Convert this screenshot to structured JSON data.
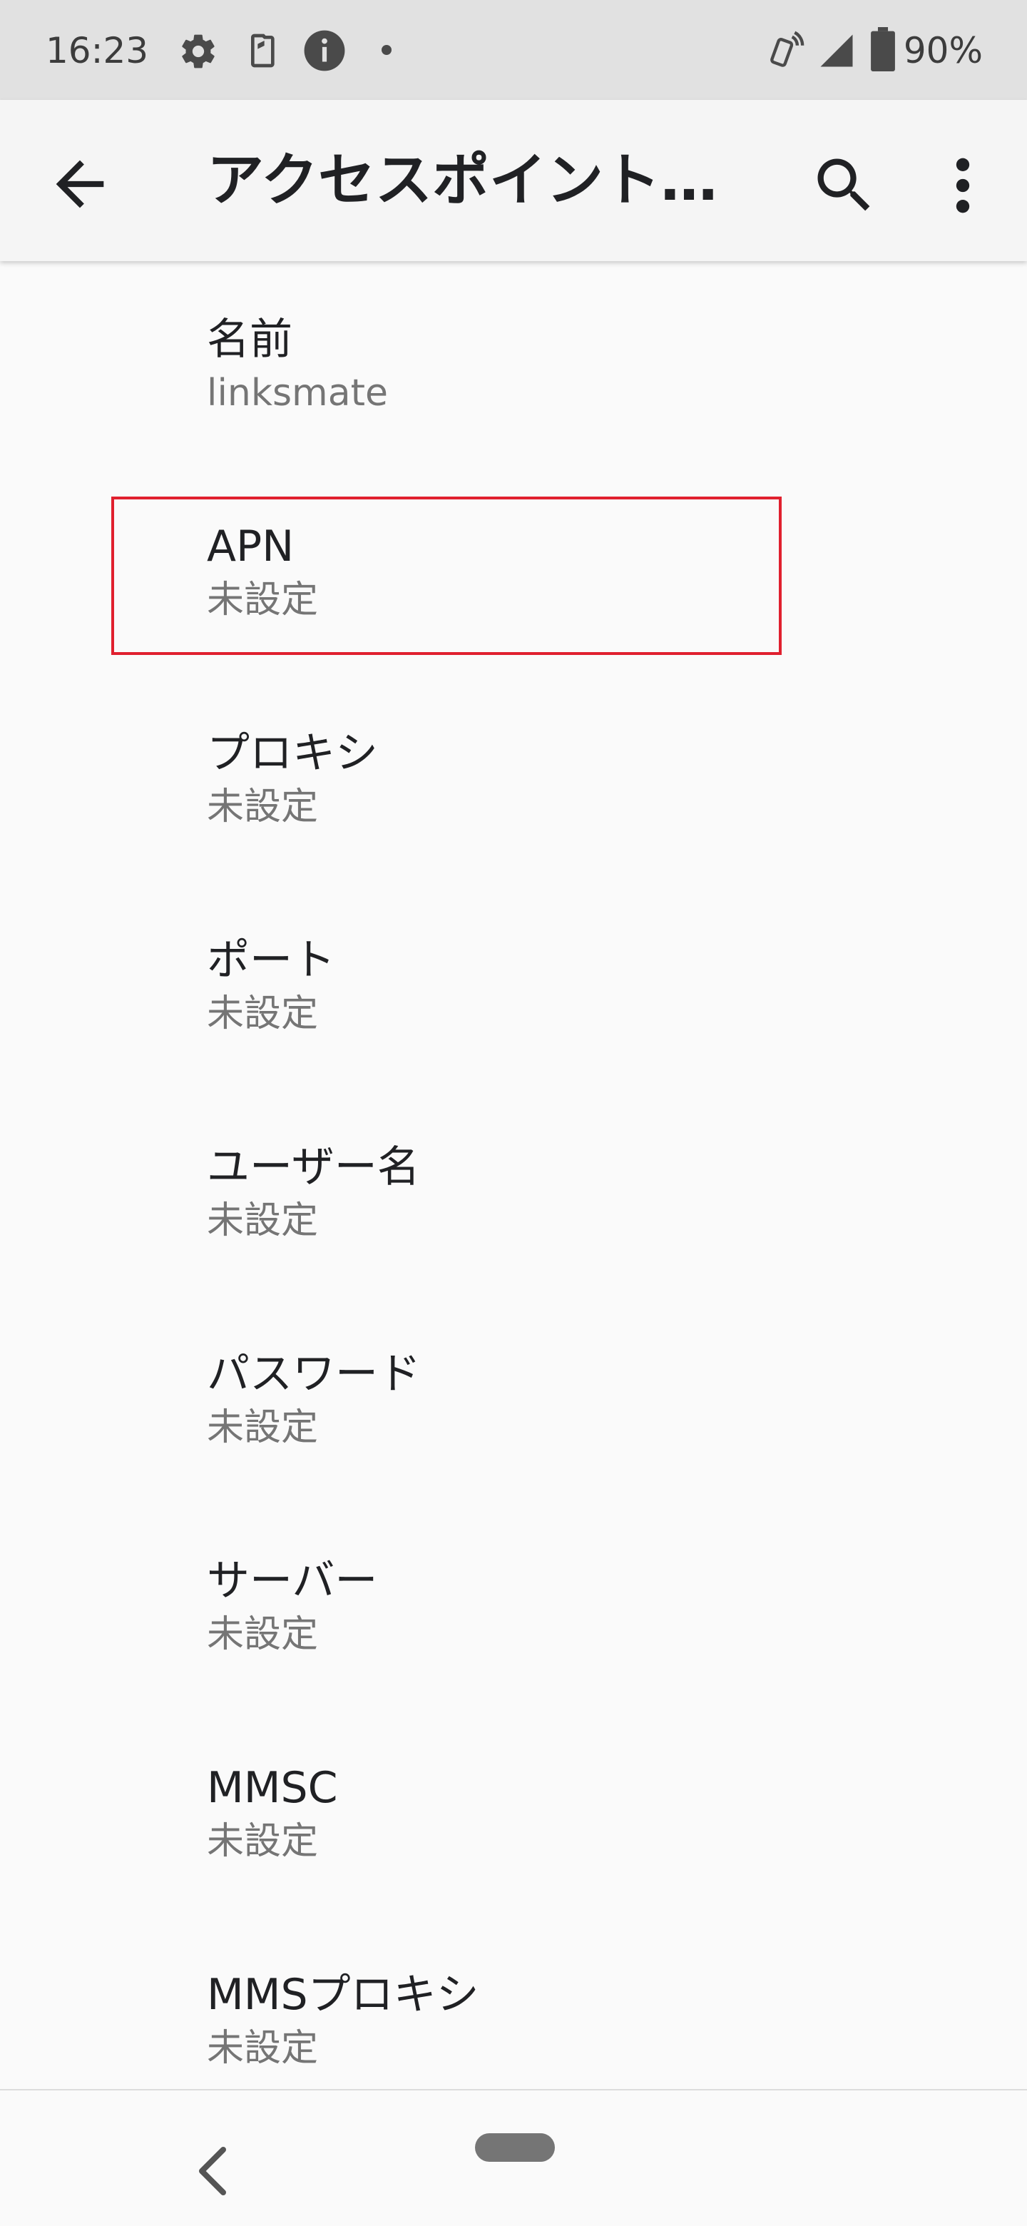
{
  "status_bar": {
    "time": "16:23",
    "battery_percent": "90%",
    "icons": [
      "gear-icon",
      "clipboard-icon",
      "info-icon",
      "dot-icon",
      "vibrate-icon",
      "signal-icon",
      "battery-icon"
    ]
  },
  "app_bar": {
    "title": "アクセスポイント…",
    "icons": [
      "back-arrow-icon",
      "search-icon",
      "more-vert-icon"
    ]
  },
  "list": {
    "items": [
      {
        "title": "名前",
        "summary": "linksmate"
      },
      {
        "title": "APN",
        "summary": "未設定"
      },
      {
        "title": "プロキシ",
        "summary": "未設定"
      },
      {
        "title": "ポート",
        "summary": "未設定"
      },
      {
        "title": "ユーザー名",
        "summary": "未設定"
      },
      {
        "title": "パスワード",
        "summary": "未設定"
      },
      {
        "title": "サーバー",
        "summary": "未設定"
      },
      {
        "title": "MMSC",
        "summary": "未設定"
      },
      {
        "title": "MMSプロキシ",
        "summary": "未設定"
      }
    ]
  },
  "nav_bar": {
    "icons": [
      "nav-back-icon",
      "home-pill-icon"
    ]
  },
  "colors": {
    "highlight": "#e0202e",
    "status_bar_bg": "#e1e1e1",
    "app_bar_bg": "#f5f5f5",
    "page_bg": "#fafafa"
  }
}
